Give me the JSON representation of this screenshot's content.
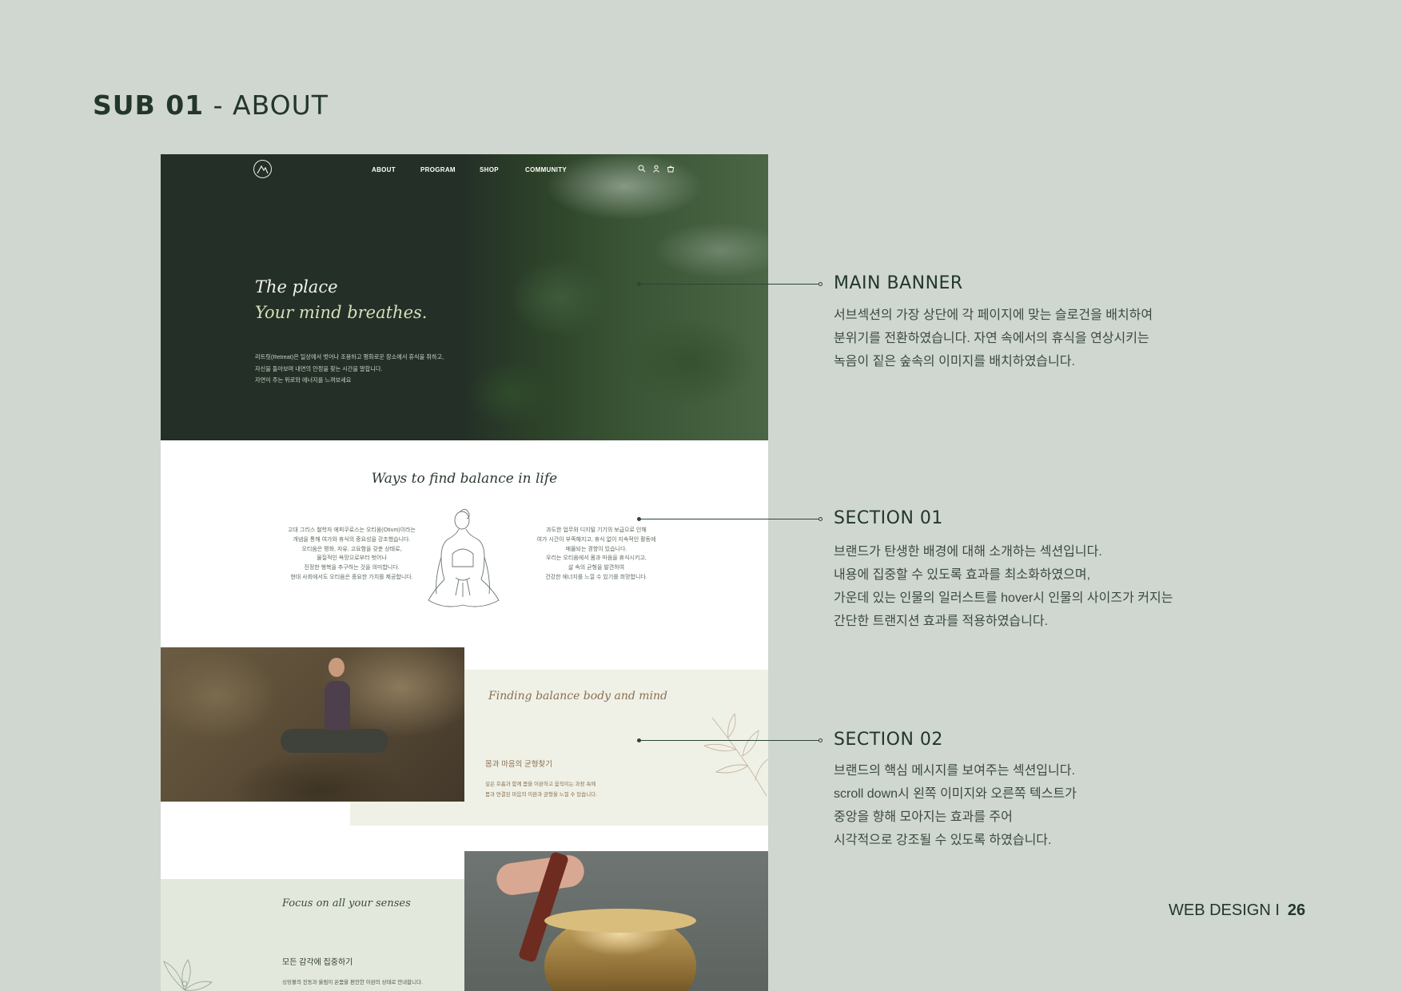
{
  "page": {
    "title_bold": "SUB 01",
    "title_light": " - ABOUT"
  },
  "site": {
    "nav": [
      "ABOUT",
      "PROGRAM",
      "SHOP",
      "COMMUNITY"
    ],
    "icons": [
      "logo-mountain-icon",
      "search-icon",
      "user-icon",
      "cart-icon"
    ],
    "banner": {
      "slogan_line1": "The place",
      "slogan_line2": "Your mind breathes.",
      "desc": [
        "리트릿(Retreat)은 일상에서 벗어나 조용하고 평화로운 장소에서 휴식을 취하고,",
        "자신을 돌아보며 내면의 안정을 찾는 시간을 말합니다.",
        "자연이 주는 위로와 에너지를 느껴보세요"
      ]
    },
    "section01": {
      "title": "Ways to find balance in life",
      "left": [
        "고대 그리스 철학자 에피쿠로스는 오티움(Otium)이라는",
        "개념을 통해 여가와 휴식의 중요성을 강조했습니다.",
        "오티움은 평화, 자유, 고요함을 갖춘 상태로,",
        "물질적인 욕망으로부터 벗어나",
        "진정한 행복을 추구하는 것을 의미합니다.",
        "현대 사회에서도 오티움은 중요한 가치를 제공합니다."
      ],
      "right": [
        "과도한 업무와 디지털 기기의 보급으로 인해",
        "여가 시간이 부족해지고, 휴식 없이 지속적인 활동에",
        "매몰되는 경향이 있습니다.",
        "우리는 오티움에서 몸과 마음을 휴식시키고,",
        "삶 속의 균형을 발견하여",
        "건강한 에너지를 느낄 수 있기를 희망합니다."
      ]
    },
    "section02": {
      "title": "Finding balance body and mind",
      "subtitle": "몸과 마음의 균형찾기",
      "desc": [
        "깊은 호흡과 함께 몸을 이완하고 움직이는 과정 속에",
        "몸과 연결된 마음의 이완과 균형을 느낄 수 있습니다."
      ]
    },
    "section03": {
      "title": "Focus on all your senses",
      "subtitle": "모든 감각에 집중하기",
      "desc": "싱잉볼의 진동과 울림이 온몸을 편안한 이완의 상태로 안내합니다."
    }
  },
  "annotations": [
    {
      "heading": "MAIN BANNER",
      "lines": [
        "서브섹션의 가장 상단에 각 페이지에 맞는 슬로건을 배치하여",
        "분위기를 전환하였습니다.  자연 속에서의 휴식을 연상시키는",
        "녹음이 짙은 숲속의 이미지를 배치하였습니다."
      ]
    },
    {
      "heading": "SECTION 01",
      "lines": [
        "브랜드가 탄생한 배경에 대해 소개하는 섹션입니다.",
        "내용에 집중할 수 있도록 효과를 최소화하였으며,",
        "가운데 있는 인물의 일러스트를 hover시 인물의 사이즈가 커지는",
        "간단한 트랜지션 효과를 적용하였습니다."
      ]
    },
    {
      "heading": "SECTION 02",
      "lines": [
        "브랜드의 핵심 메시지를 보여주는 섹션입니다.",
        "scroll down시 왼쪽 이미지와 오른쪽 텍스트가",
        "중앙을 향해 모아지는 효과를 주어",
        "시각적으로 강조될 수 있도록 하였습니다."
      ]
    }
  ],
  "footer": {
    "label": "WEB DESIGN I",
    "page_number": "26"
  },
  "colors": {
    "background": "#d0d7d0",
    "banner_dark": "#243027",
    "accent_brown": "#8a6e52",
    "heading_green": "#22372a"
  }
}
